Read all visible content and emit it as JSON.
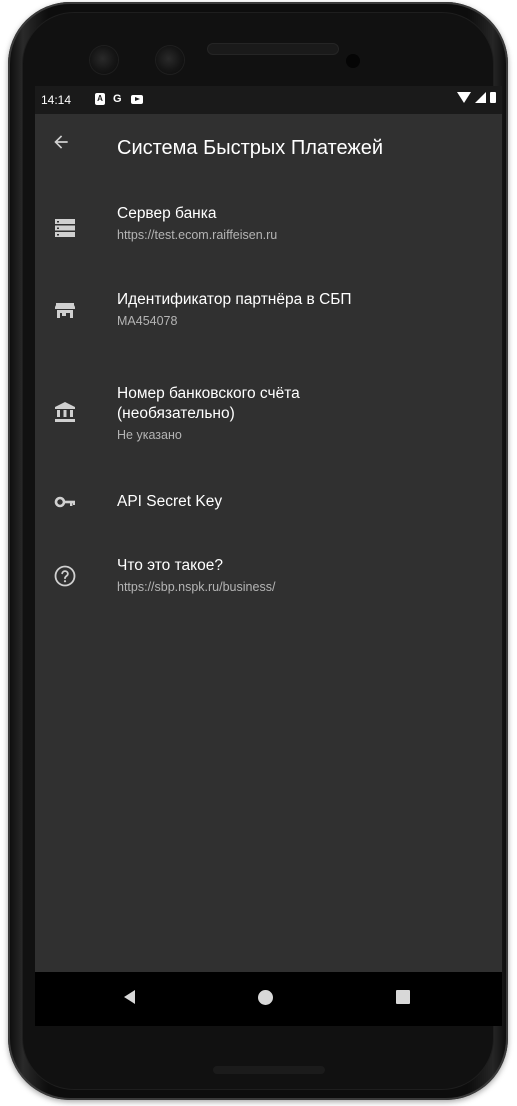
{
  "status_bar": {
    "time": "14:14",
    "notification_icons": [
      "a-icon",
      "google-g-icon",
      "youtube-icon"
    ],
    "g_label": "G",
    "system_icons": [
      "wifi-icon",
      "signal-icon",
      "battery-icon"
    ]
  },
  "app_bar": {
    "back_icon": "arrow-back-icon",
    "title": "Система Быстрых Платежей"
  },
  "settings": [
    {
      "icon": "server-icon",
      "title": "Сервер банка",
      "summary": "https://test.ecom.raiffeisen.ru"
    },
    {
      "icon": "store-icon",
      "title": "Идентификатор партнёра в СБП",
      "summary": "MA454078"
    },
    {
      "icon": "bank-icon",
      "title_line1": "Номер банковского счёта",
      "title_line2": "(необязательно)",
      "summary": "Не указано"
    },
    {
      "icon": "key-icon",
      "title": "API Secret Key"
    },
    {
      "icon": "help-circle-icon",
      "title": "Что это такое?",
      "summary": "https://sbp.nspk.ru/business/"
    }
  ],
  "nav_bar": {
    "buttons": [
      "nav-back-icon",
      "nav-home-icon",
      "nav-recents-icon"
    ]
  },
  "colors": {
    "screen_bg": "#303030",
    "status_bar_bg": "#1a1a1a",
    "nav_bar_bg": "#000000",
    "primary_text": "#ffffff",
    "secondary_text": "#b4b4b4",
    "icon": "#d0d0d0"
  }
}
